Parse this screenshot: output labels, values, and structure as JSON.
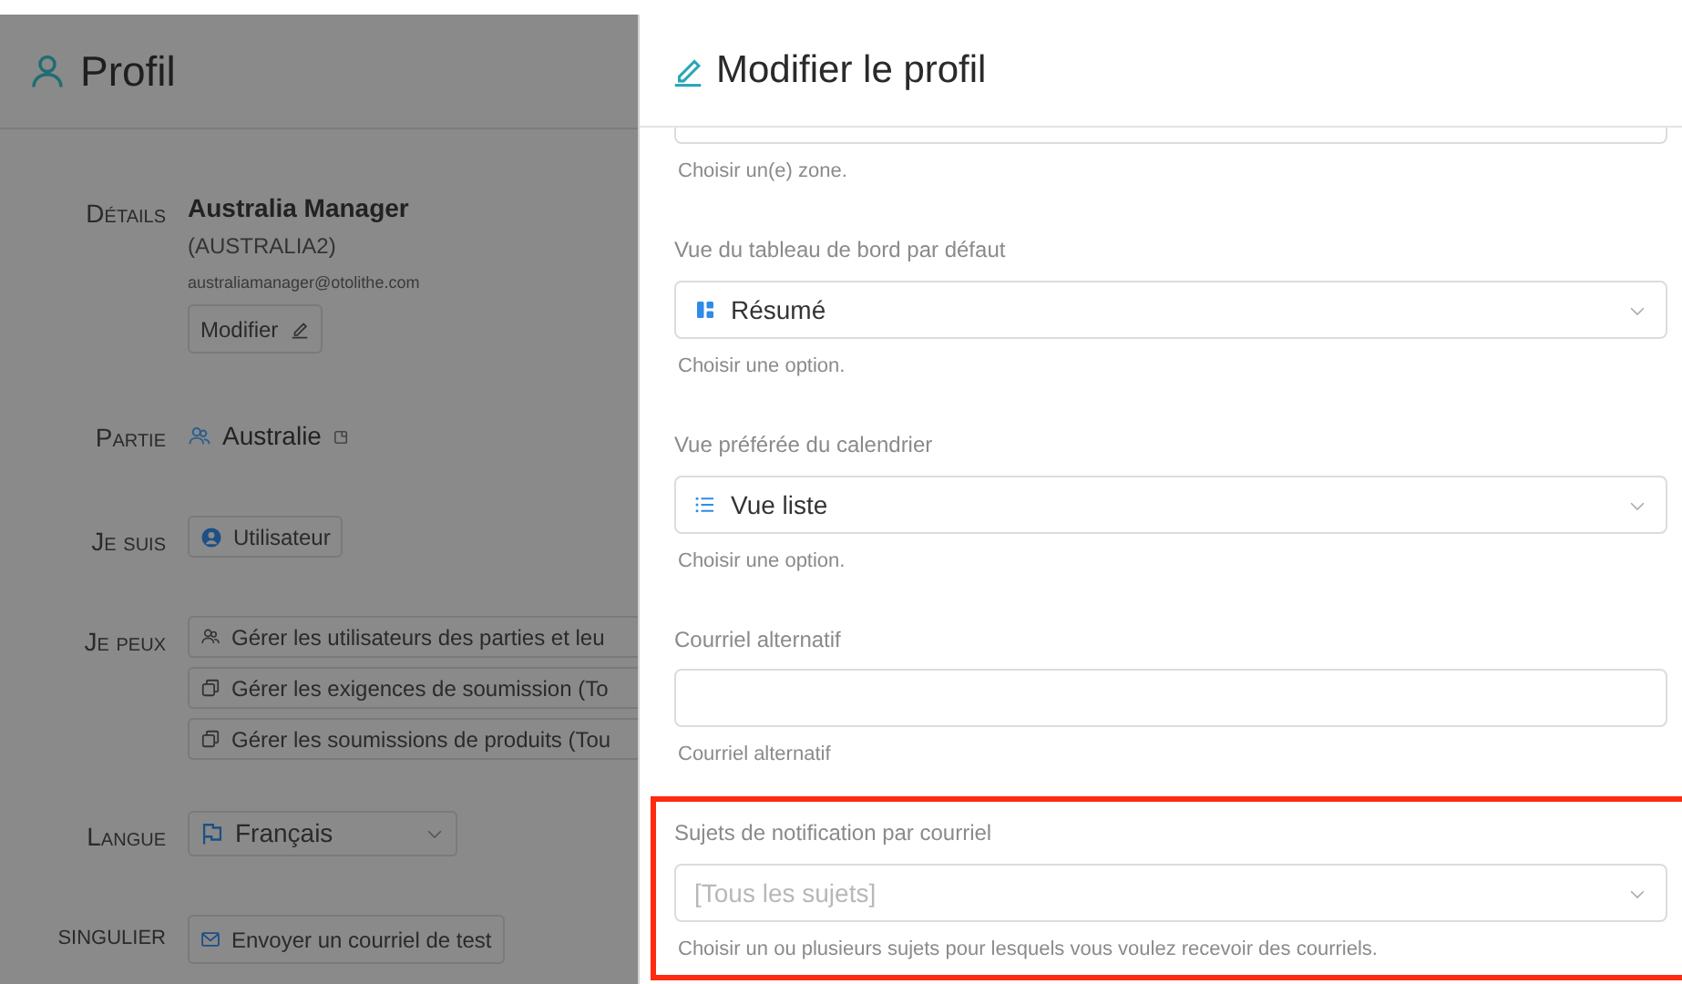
{
  "profile": {
    "title": "Profil",
    "details": {
      "label": "Détails",
      "name": "Australia Manager",
      "username": "(AUSTRALIA2)",
      "email": "australiamanager@otolithe.com",
      "edit_button": "Modifier"
    },
    "party": {
      "label": "Partie",
      "value": "Australie"
    },
    "role": {
      "label": "Je suis",
      "value": "Utilisateur"
    },
    "permissions": {
      "label": "Je peux",
      "items": [
        {
          "kind": "users",
          "text": "Gérer les utilisateurs des parties et leu"
        },
        {
          "kind": "copy",
          "text": "Gérer les exigences de soumission (To"
        },
        {
          "kind": "copy",
          "text": "Gérer les soumissions de produits (Tou"
        }
      ]
    },
    "language": {
      "label": "Langue",
      "value": "Français"
    },
    "single": {
      "label": "SINGULIER",
      "button": "Envoyer un courriel de test"
    }
  },
  "drawer": {
    "title": "Modifier le profil",
    "fields": [
      {
        "kind": "cut",
        "hint": "Choisir un(e) zone."
      },
      {
        "kind": "select",
        "label": "Vue du tableau de bord par défaut",
        "value": "Résumé",
        "hint": "Choisir une option.",
        "highlighted": false
      },
      {
        "kind": "select",
        "label": "Vue préférée du calendrier",
        "value": "Vue liste",
        "hint": "Choisir une option.",
        "highlighted": false
      },
      {
        "kind": "input",
        "label": "Courriel alternatif",
        "hint": "Courriel alternatif",
        "highlighted": false
      },
      {
        "kind": "select",
        "label": "Sujets de notification par courriel",
        "placeholder": "[Tous les sujets]",
        "hint": "Choisir un ou plusieurs sujets pour lesquels vous voulez recevoir des courriels.",
        "highlighted": true
      }
    ]
  }
}
